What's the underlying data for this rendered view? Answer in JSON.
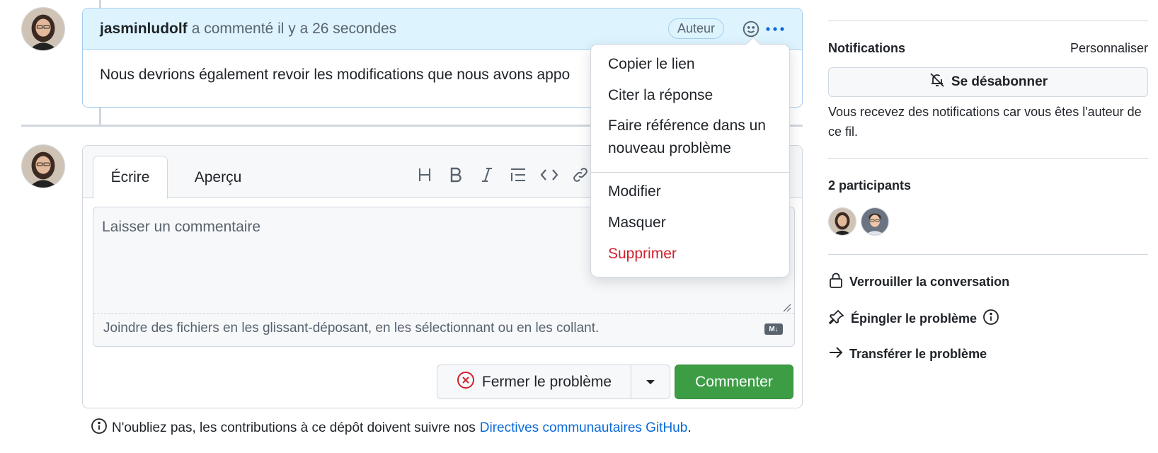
{
  "comment": {
    "author": "jasminludolf",
    "meta": "a commenté il y a 26 secondes",
    "badge": "Auteur",
    "body": "Nous devrions également revoir les modifications que nous avons appo"
  },
  "menu": {
    "items": [
      "Copier le lien",
      "Citer la réponse",
      "Faire référence dans un",
      "nouveau problème",
      "Modifier",
      "Masquer",
      "Supprimer"
    ]
  },
  "editor": {
    "tabs": [
      "Écrire",
      "Aperçu"
    ],
    "placeholder": "Laisser un commentaire",
    "attach_text": "Joindre des fichiers en les glissant-déposant, en les sélectionnant ou en les collant.",
    "md_badge": "M↓",
    "toolbar_icons": [
      "heading-icon",
      "bold-icon",
      "italic-icon",
      "list-icon",
      "code-icon",
      "link-icon"
    ],
    "close_label": "Fermer le problème",
    "comment_label": "Commenter"
  },
  "guidelines": {
    "prefix": "N'oubliez pas, les contributions à ce dépôt doivent suivre nos",
    "link": "Directives communautaires GitHub",
    "suffix": "."
  },
  "sidebar": {
    "notifications_heading": "Notifications",
    "customize": "Personnaliser",
    "unsubscribe": "Se désabonner",
    "note": "Vous recevez des notifications car vous êtes l'auteur de ce fil.",
    "participants_heading": "2 participants",
    "actions": [
      "Verrouiller la conversation",
      "Épingler le problème",
      "Transférer le problème"
    ]
  },
  "colors": {
    "accent_blue": "#0969da",
    "comment_header_bg": "#ddf4ff",
    "primary_green": "#3d9d45",
    "danger_red": "#cf222e"
  }
}
